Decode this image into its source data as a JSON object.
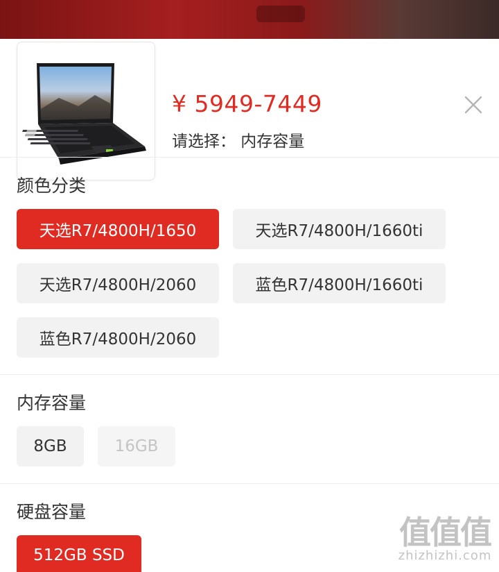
{
  "header": {
    "price": "¥ 5949-7449",
    "select_hint": "请选择： 内存容量"
  },
  "icons": {
    "close": "close-icon",
    "product": "laptop-image"
  },
  "sections": [
    {
      "title": "颜色分类",
      "options": [
        {
          "label": "天选R7/4800H/1650",
          "state": "selected"
        },
        {
          "label": "天选R7/4800H/1660ti",
          "state": "normal"
        },
        {
          "label": "天选R7/4800H/2060",
          "state": "normal"
        },
        {
          "label": "蓝色R7/4800H/1660ti",
          "state": "normal"
        },
        {
          "label": "蓝色R7/4800H/2060",
          "state": "normal"
        }
      ]
    },
    {
      "title": "内存容量",
      "options": [
        {
          "label": "8GB",
          "state": "normal"
        },
        {
          "label": "16GB",
          "state": "disabled"
        }
      ]
    },
    {
      "title": "硬盘容量",
      "options": [
        {
          "label": "512GB SSD",
          "state": "selected"
        }
      ]
    }
  ],
  "watermark": {
    "glyphs": "值值值",
    "url": "zhizhizhi.com"
  },
  "colors": {
    "accent": "#e02b22",
    "chip_bg": "#f2f2f2",
    "disabled_text": "#c4c4c4"
  }
}
